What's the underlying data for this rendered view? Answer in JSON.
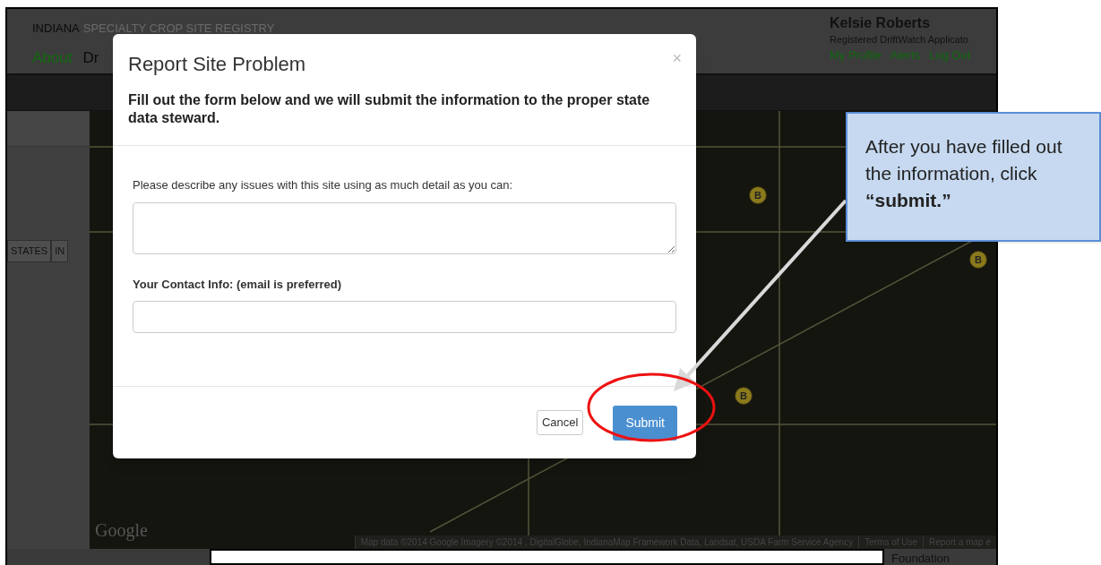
{
  "header": {
    "brand_strong": "INDIANA",
    "brand_rest": "SPECIALTY CROP SITE REGISTRY",
    "nav": [
      "About",
      "Dr"
    ],
    "user": {
      "name": "Kelsie Roberts",
      "role": "Registered DriftWatch Applicato",
      "links": [
        "My Profile",
        "Alerts",
        "Log Out"
      ]
    }
  },
  "sidebar": {
    "toggles": [
      {
        "label": "STATES"
      },
      {
        "label": "IN"
      }
    ]
  },
  "map": {
    "markers": [
      {
        "label": "B"
      },
      {
        "label": "B"
      },
      {
        "label": "B"
      }
    ],
    "logo": "Google",
    "attribution": [
      "Map data ©2014 Google Imagery ©2014 , DigitalGlobe, IndianaMap Framework Data, Landsat, USDA Farm Service Agency",
      "Terms of Use",
      "Report a map e"
    ]
  },
  "footer": {
    "side_label": "Foundation"
  },
  "modal": {
    "title": "Report Site Problem",
    "close": "×",
    "subtitle": "Fill out the form below and we will submit the information to the proper state data steward.",
    "fields": [
      {
        "kind": "textarea",
        "label": "Please describe any issues with this site using as much detail as you can:"
      },
      {
        "kind": "input",
        "label": "Your Contact Info: (email is preferred)"
      }
    ],
    "buttons": [
      {
        "label": "Cancel",
        "kind": "default"
      },
      {
        "label": "Submit",
        "kind": "primary"
      }
    ]
  },
  "callout": {
    "text": "After you have filled out the information, click **“submit.”**"
  }
}
